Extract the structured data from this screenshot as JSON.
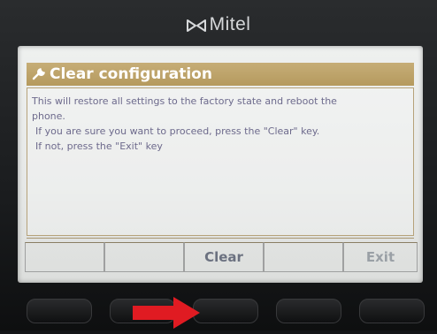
{
  "device": {
    "brand": "Mitel"
  },
  "screen": {
    "title": "Clear configuration",
    "message_line1": "This will restore all settings to the factory state and reboot the",
    "message_line2": "phone.",
    "message_line3": "If you are sure you want to proceed, press the \"Clear\" key.",
    "message_line4": "If not, press the \"Exit\" key"
  },
  "softkeys": [
    "",
    "",
    "Clear",
    "",
    "Exit"
  ],
  "icons": {
    "brand_logo": "mitel-logo-icon",
    "title_icon": "wrench-icon",
    "pointer": "red-arrow-icon"
  },
  "colors": {
    "title_bar": "#b59a5e",
    "message_text": "#6d6a8c",
    "arrow": "#e01b22"
  }
}
